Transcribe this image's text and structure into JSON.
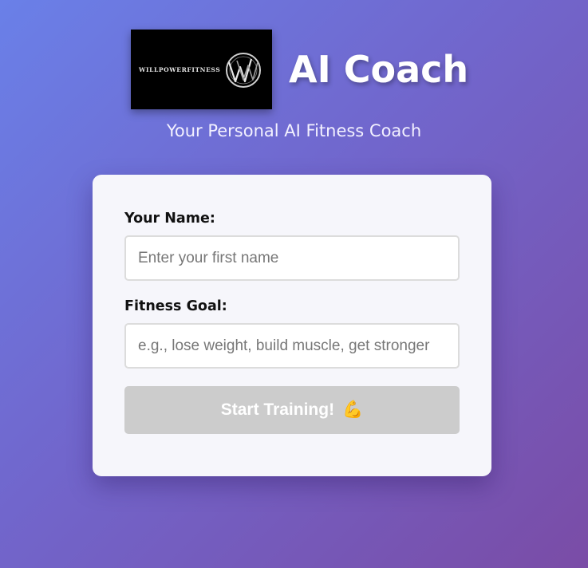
{
  "header": {
    "logo_text": "WILLPOWERFITNESS",
    "title": "AI Coach",
    "subtitle": "Your Personal AI Fitness Coach"
  },
  "form": {
    "name_label": "Your Name:",
    "name_placeholder": "Enter your first name",
    "name_value": "",
    "goal_label": "Fitness Goal:",
    "goal_placeholder": "e.g., lose weight, build muscle, get stronger",
    "goal_value": "",
    "submit_label": "Start Training!",
    "submit_emoji": "💪",
    "submit_icon": "flexed-biceps-icon",
    "submit_disabled": true
  },
  "colors": {
    "background_start": "#6a80e8",
    "background_end": "#7a4ca6",
    "card_bg": "#f6f6fb",
    "button_disabled": "#cccccc"
  }
}
